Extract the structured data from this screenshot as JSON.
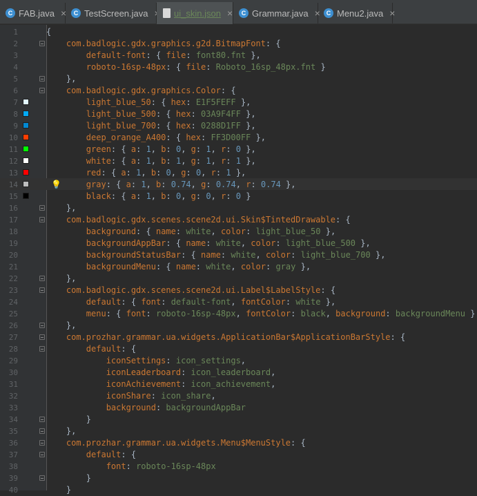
{
  "tabs": [
    {
      "label": "FAB.java",
      "icon": "class-icon",
      "active": false
    },
    {
      "label": "TestScreen.java",
      "icon": "class-icon",
      "active": false
    },
    {
      "label": "ui_skin.json",
      "icon": "json-file-icon",
      "active": true
    },
    {
      "label": "Grammar.java",
      "icon": "class-icon",
      "active": false
    },
    {
      "label": "Menu2.java",
      "icon": "class-icon",
      "active": false
    }
  ],
  "caret_line": 14,
  "lines": [
    {
      "n": "1",
      "text": "{"
    },
    {
      "n": "2",
      "text": "    com.badlogic.gdx.graphics.g2d.BitmapFont: {"
    },
    {
      "n": "3",
      "text": "        default-font: { file: font80.fnt },"
    },
    {
      "n": "4",
      "text": "        roboto-16sp-48px: { file: Roboto_16sp_48px.fnt }"
    },
    {
      "n": "5",
      "text": "    },"
    },
    {
      "n": "6",
      "text": "    com.badlogic.gdx.graphics.Color: {"
    },
    {
      "n": "7",
      "text": "        light_blue_50: { hex: E1F5FEFF },",
      "swatch": "#e1f5fe"
    },
    {
      "n": "8",
      "text": "        light_blue_500: { hex: 03A9F4FF },",
      "swatch": "#03a9f4"
    },
    {
      "n": "9",
      "text": "        light_blue_700: { hex: 0288D1FF },",
      "swatch": "#0288d1"
    },
    {
      "n": "10",
      "text": "        deep_orange_A400: { hex: FF3D00FF },",
      "swatch": "#ff3d00"
    },
    {
      "n": "11",
      "text": "        green: { a: 1, b: 0, g: 1, r: 0 },",
      "swatch": "#00ff00"
    },
    {
      "n": "12",
      "text": "        white: { a: 1, b: 1, g: 1, r: 1 },",
      "swatch": "#ffffff"
    },
    {
      "n": "13",
      "text": "        red: { a: 1, b: 0, g: 0, r: 1 },",
      "swatch": "#ff0000"
    },
    {
      "n": "14",
      "text": "        gray: { a: 1, b: 0.74, g: 0.74, r: 0.74 },",
      "swatch": "#bdbdbd",
      "bulb": true
    },
    {
      "n": "15",
      "text": "        black: { a: 1, b: 0, g: 0, r: 0 }",
      "swatch": "#000000"
    },
    {
      "n": "16",
      "text": "    },"
    },
    {
      "n": "17",
      "text": "    com.badlogic.gdx.scenes.scene2d.ui.Skin$TintedDrawable: {"
    },
    {
      "n": "18",
      "text": "        background: { name: white, color: light_blue_50 },"
    },
    {
      "n": "19",
      "text": "        backgroundAppBar: { name: white, color: light_blue_500 },"
    },
    {
      "n": "20",
      "text": "        backgroundStatusBar: { name: white, color: light_blue_700 },"
    },
    {
      "n": "21",
      "text": "        backgroundMenu: { name: white, color: gray },"
    },
    {
      "n": "22",
      "text": "    },"
    },
    {
      "n": "23",
      "text": "    com.badlogic.gdx.scenes.scene2d.ui.Label$LabelStyle: {"
    },
    {
      "n": "24",
      "text": "        default: { font: default-font, fontColor: white },"
    },
    {
      "n": "25",
      "text": "        menu: { font: roboto-16sp-48px, fontColor: black, background: backgroundMenu }"
    },
    {
      "n": "26",
      "text": "    },"
    },
    {
      "n": "27",
      "text": "    com.prozhar.grammar.ua.widgets.ApplicationBar$ApplicationBarStyle: {"
    },
    {
      "n": "28",
      "text": "        default: {"
    },
    {
      "n": "29",
      "text": "            iconSettings: icon_settings,"
    },
    {
      "n": "30",
      "text": "            iconLeaderboard: icon_leaderboard,"
    },
    {
      "n": "31",
      "text": "            iconAchievement: icon_achievement,"
    },
    {
      "n": "32",
      "text": "            iconShare: icon_share,"
    },
    {
      "n": "33",
      "text": "            background: backgroundAppBar"
    },
    {
      "n": "34",
      "text": "        }"
    },
    {
      "n": "35",
      "text": "    },"
    },
    {
      "n": "36",
      "text": "    com.prozhar.grammar.ua.widgets.Menu$MenuStyle: {"
    },
    {
      "n": "37",
      "text": "        default: {"
    },
    {
      "n": "38",
      "text": "            font: roboto-16sp-48px"
    },
    {
      "n": "39",
      "text": "        }"
    },
    {
      "n": "40",
      "text": "    }"
    }
  ],
  "colors": {
    "background": "#2b2b2b",
    "gutter": "#313335",
    "key": "#cc7832",
    "string_value": "#6a8759",
    "number": "#6897bb",
    "punctuation": "#a9b7c6",
    "line_number": "#606366"
  }
}
